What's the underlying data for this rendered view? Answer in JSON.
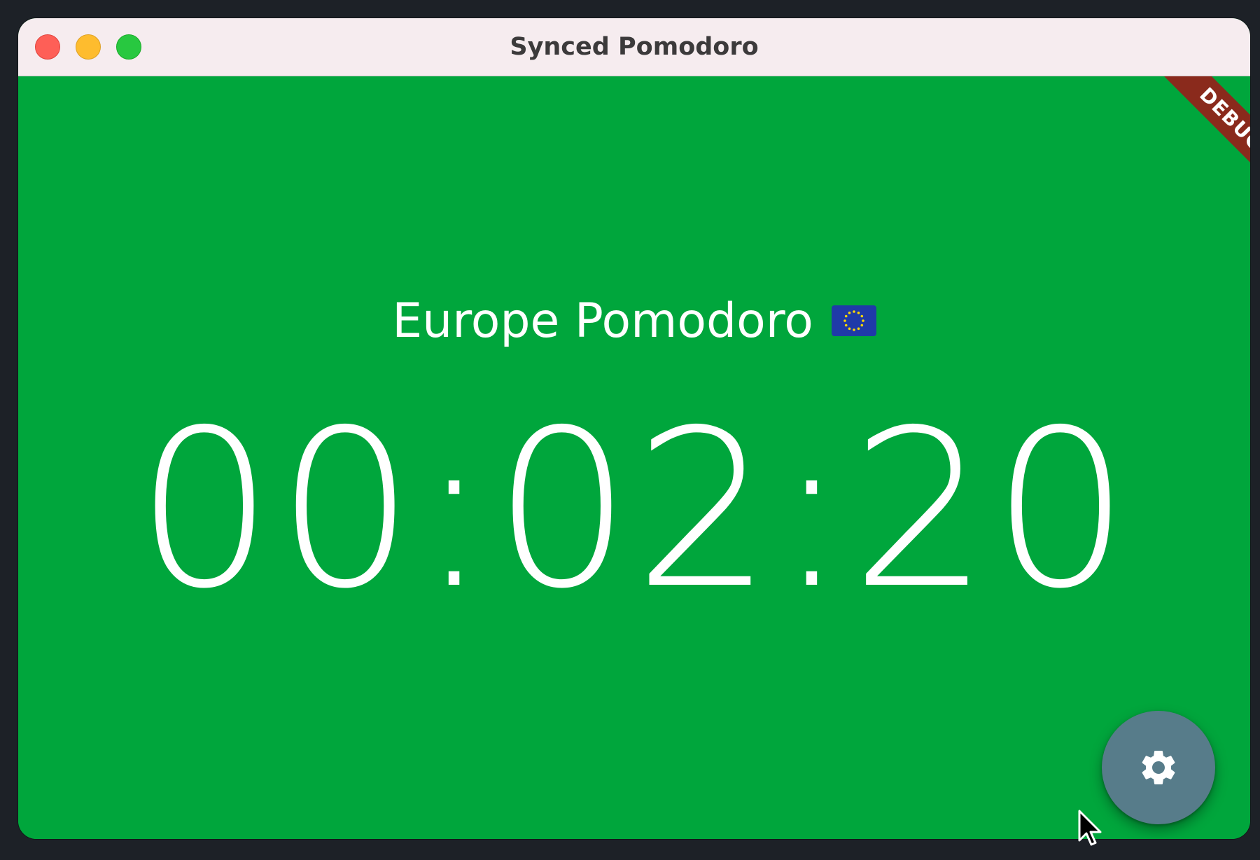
{
  "window": {
    "title": "Synced Pomodoro"
  },
  "banner": {
    "label": "DEBUG"
  },
  "session": {
    "name": "Europe Pomodoro",
    "flag_icon": "eu-flag-icon",
    "remaining_time": "00:02:20"
  },
  "settings_button": {
    "icon": "gear-icon"
  },
  "colors": {
    "background": "#00a63c",
    "titlebar": "#f6ecef",
    "fab": "#577c8a",
    "debug_banner": "#8a2a1c",
    "text": "#ffffff"
  }
}
